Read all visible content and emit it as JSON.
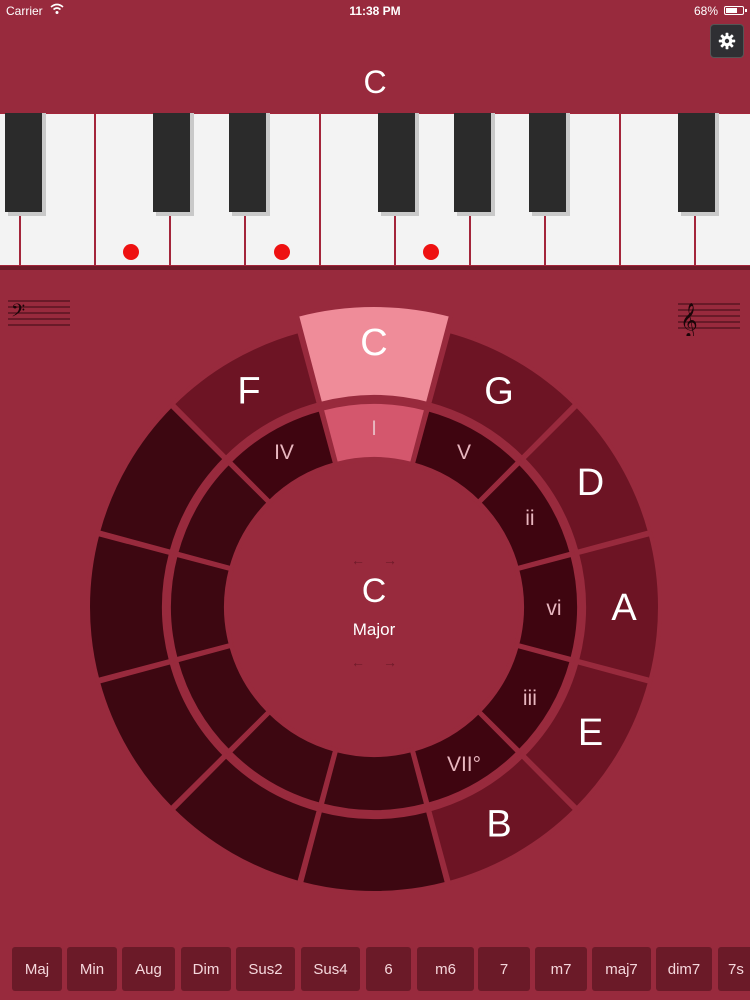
{
  "status_bar": {
    "carrier": "Carrier",
    "time": "11:38 PM",
    "battery": "68%"
  },
  "current_note": "C",
  "keyboard": {
    "highlighted_notes": [
      "C",
      "E",
      "G"
    ]
  },
  "wheel": {
    "outer_keys": [
      "C",
      "G",
      "D",
      "A",
      "E",
      "B",
      "",
      "",
      "",
      "",
      "",
      "F"
    ],
    "inner_degrees": [
      "I",
      "V",
      "ii",
      "vi",
      "iii",
      "VII°",
      "",
      "",
      "",
      "",
      "",
      "IV"
    ],
    "selected": "C",
    "center": {
      "root": "C",
      "quality": "Major"
    }
  },
  "chord_types": [
    "Maj",
    "Min",
    "Aug",
    "Dim",
    "Sus2",
    "Sus4",
    "6",
    "m6",
    "7",
    "m7",
    "maj7",
    "dim7",
    "7s"
  ],
  "colors": {
    "background": "#982a3d",
    "selected_outer": "#ef8c99",
    "selected_inner": "#d4576d",
    "diatonic_outer": "#6d1424",
    "diatonic_inner": "#3f0510",
    "inactive": "#3d0711",
    "note_dot": "#ee1111"
  }
}
